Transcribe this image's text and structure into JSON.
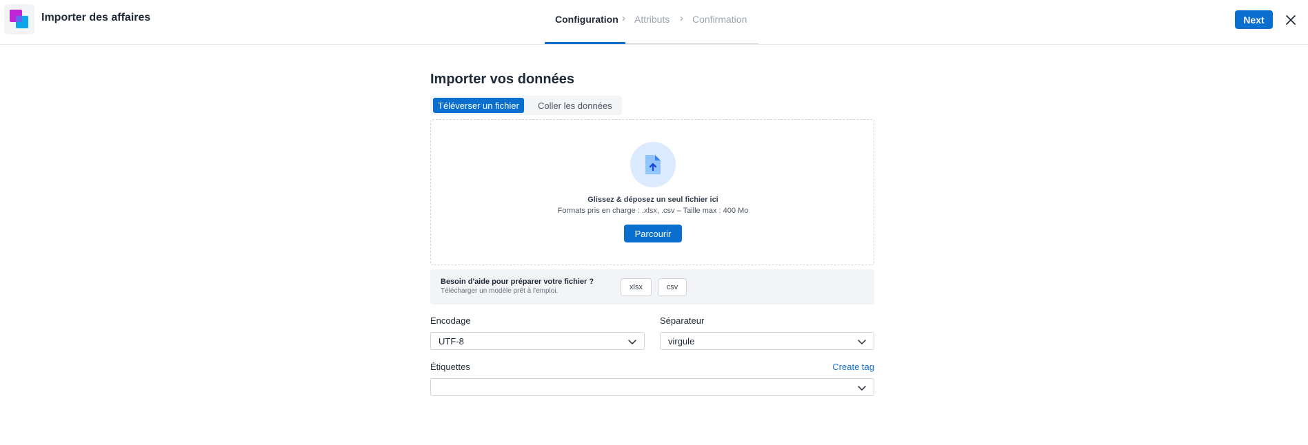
{
  "header": {
    "app_title": "Importer des affaires",
    "steps": [
      {
        "label": "Configuration",
        "state": "active"
      },
      {
        "label": "Attributs",
        "state": "inactive"
      },
      {
        "label": "Confirmation",
        "state": "inactive"
      }
    ],
    "step_separator": "›",
    "next_label": "Next",
    "close_icon": "close-icon"
  },
  "main": {
    "title": "Importer vos données",
    "tabs": [
      {
        "label": "Téléverser un fichier",
        "active": true
      },
      {
        "label": "Coller les données",
        "active": false
      }
    ],
    "dropzone": {
      "icon": "file-upload-icon",
      "title": "Glissez & déposez un seul fichier ici",
      "subtitle": "Formats pris en charge : .xlsx, .csv – Taille max : 400 Mo",
      "browse_label": "Parcourir"
    },
    "help": {
      "title": "Besoin d'aide pour préparer votre fichier ?",
      "subtitle": "Télécharger un modèle prêt à l'emploi.",
      "templates": [
        "xlsx",
        "csv"
      ]
    },
    "encoding": {
      "label": "Encodage",
      "value": "UTF-8"
    },
    "separator": {
      "label": "Séparateur",
      "value": "virgule"
    },
    "tags": {
      "label": "Étiquettes",
      "value": "",
      "create_label": "Create tag"
    }
  },
  "colors": {
    "accent": "#0b6fcf",
    "border": "#d1d5db",
    "muted_text": "#9ca3af",
    "panel_bg": "#f3f4f6"
  }
}
